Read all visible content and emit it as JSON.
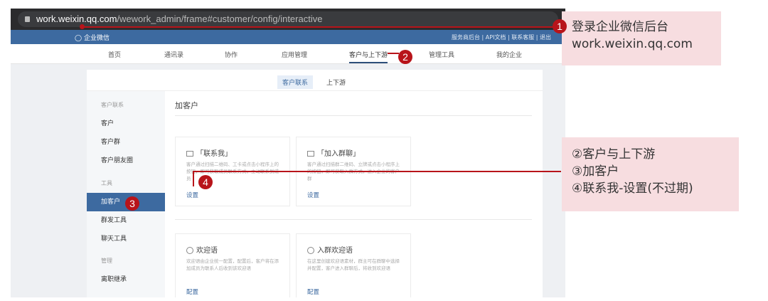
{
  "browser": {
    "url_host": "work.weixin.qq.com",
    "url_path": "/wework_admin/frame#customer/config/interactive"
  },
  "header": {
    "logo": "企业微信",
    "links": [
      "服务商后台",
      "API文档",
      "联系客服",
      "退出"
    ]
  },
  "nav": {
    "items": [
      "首页",
      "通讯录",
      "协作",
      "应用管理",
      "客户与上下游",
      "管理工具",
      "我的企业"
    ],
    "active": "客户与上下游"
  },
  "tabs": [
    "客户联系",
    "上下游"
  ],
  "sidebar": {
    "items": [
      {
        "label": "客户联系",
        "type": "group"
      },
      {
        "label": "客户"
      },
      {
        "label": "客户群"
      },
      {
        "label": "客户朋友圈"
      },
      {
        "label": "工具",
        "type": "group"
      },
      {
        "label": "加客户",
        "active": true
      },
      {
        "label": "群发工具"
      },
      {
        "label": "聊天工具"
      },
      {
        "label": "管理",
        "type": "group"
      },
      {
        "label": "离职继承"
      }
    ]
  },
  "main": {
    "title": "加客户",
    "cards": [
      {
        "title": "「联系我」",
        "desc": "客户通过扫描二维码、工卡或点击小程序上的按钮，即可获取成员联系方式，主动联系到成员",
        "link": "设置"
      },
      {
        "title": "「加入群聊」",
        "desc": "客户通过扫描群二维码、立牌或点击小程序上的按钮，即可获取入群方式，进入企业的客户群",
        "link": "设置"
      },
      {
        "title": "欢迎语",
        "desc": "欢迎语由企业统一配置，配置后，客户将在添加成员为联系人后收到该欢迎语",
        "link": "配置"
      },
      {
        "title": "入群欢迎语",
        "desc": "在这里创建欢迎语素材，群主可在群聊中选择并配置，客户进入群聊后，将收到欢迎语",
        "link": "配置"
      }
    ]
  },
  "annotations": {
    "badges": [
      "1",
      "2",
      "3",
      "4"
    ],
    "note1": [
      "登录企业微信后台",
      "work.weixin.qq.com"
    ],
    "note2": [
      "②客户与上下游",
      "③加客户",
      "④联系我-设置(不过期)"
    ]
  },
  "colors": {
    "accent": "#3d6aa0",
    "annotation": "#b8141a",
    "note_bg": "#f7dde0"
  }
}
